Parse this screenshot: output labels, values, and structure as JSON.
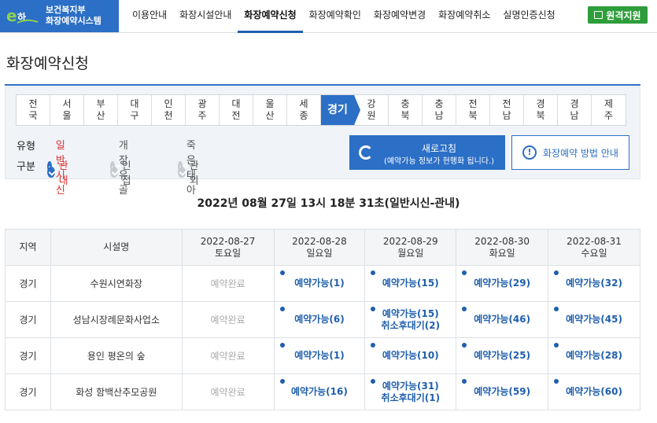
{
  "header": {
    "logo_line1": "보건복지부",
    "logo_line2": "화장예약시스템",
    "nav": [
      "이용안내",
      "화장시설안내",
      "화장예약신청",
      "화장예약확인",
      "화장예약변경",
      "화장예약취소",
      "실명인증신청"
    ],
    "active_nav": 2,
    "remote_label": "원격지원"
  },
  "page_title": "화장예약신청",
  "regions": [
    {
      "top": "전",
      "bottom": "국"
    },
    {
      "top": "서",
      "bottom": "울"
    },
    {
      "top": "부",
      "bottom": "산"
    },
    {
      "top": "대",
      "bottom": "구"
    },
    {
      "top": "인",
      "bottom": "천"
    },
    {
      "top": "광",
      "bottom": "주"
    },
    {
      "top": "대",
      "bottom": "전"
    },
    {
      "top": "울",
      "bottom": "산"
    },
    {
      "top": "세",
      "bottom": "종"
    },
    {
      "top": "경기",
      "bottom": ""
    },
    {
      "top": "강",
      "bottom": "원"
    },
    {
      "top": "충",
      "bottom": "북"
    },
    {
      "top": "충",
      "bottom": "남"
    },
    {
      "top": "전",
      "bottom": "북"
    },
    {
      "top": "전",
      "bottom": "남"
    },
    {
      "top": "경",
      "bottom": "북"
    },
    {
      "top": "경",
      "bottom": "남"
    },
    {
      "top": "제",
      "bottom": "주"
    }
  ],
  "filters": {
    "type_label": "유형",
    "type_options": [
      {
        "label": "일반시신",
        "checked": true
      },
      {
        "label": "개장유골",
        "checked": false
      },
      {
        "label": "죽은태아",
        "checked": false
      }
    ],
    "area_label": "구분",
    "area_options": [
      {
        "label": "관내",
        "checked": true
      },
      {
        "label": "인접",
        "checked": false
      },
      {
        "label": "관외",
        "checked": false
      }
    ]
  },
  "refresh": {
    "title": "새로고침",
    "subtitle": "(예약가능 정보가 현행화 됩니다.)"
  },
  "guide_label": "화장예약 방법 안내",
  "timestamp": "2022년 08월 27일 13시 18분 31초(일반시신-관내)",
  "table": {
    "col_region": "지역",
    "col_facility": "시설명",
    "dates": [
      {
        "date": "2022-08-27",
        "day": "토요일"
      },
      {
        "date": "2022-08-28",
        "day": "일요일"
      },
      {
        "date": "2022-08-29",
        "day": "월요일"
      },
      {
        "date": "2022-08-30",
        "day": "화요일"
      },
      {
        "date": "2022-08-31",
        "day": "수요일"
      }
    ],
    "rows": [
      {
        "region": "경기",
        "facility": "수원시연화장",
        "cells": [
          [
            "예약완료"
          ],
          [
            "예약가능(1)"
          ],
          [
            "예약가능(15)"
          ],
          [
            "예약가능(29)"
          ],
          [
            "예약가능(32)"
          ]
        ]
      },
      {
        "region": "경기",
        "facility": "성남시장례문화사업소",
        "cells": [
          [
            "예약완료"
          ],
          [
            "예약가능(6)"
          ],
          [
            "예약가능(15)",
            "취소후대기(2)"
          ],
          [
            "예약가능(46)"
          ],
          [
            "예약가능(45)"
          ]
        ]
      },
      {
        "region": "경기",
        "facility": "용인 평온의 숲",
        "cells": [
          [
            "예약완료"
          ],
          [
            "예약가능(1)"
          ],
          [
            "예약가능(10)"
          ],
          [
            "예약가능(25)"
          ],
          [
            "예약가능(28)"
          ]
        ]
      },
      {
        "region": "경기",
        "facility": "화성 함백산추모공원",
        "cells": [
          [
            "예약완료"
          ],
          [
            "예약가능(16)"
          ],
          [
            "예약가능(31)",
            "취소후대기(1)"
          ],
          [
            "예약가능(59)"
          ],
          [
            "예약가능(60)"
          ]
        ]
      }
    ]
  },
  "colors": {
    "brand": "#2b6fc6",
    "selected_text": "#e03030",
    "remote": "#2e9d3b"
  }
}
